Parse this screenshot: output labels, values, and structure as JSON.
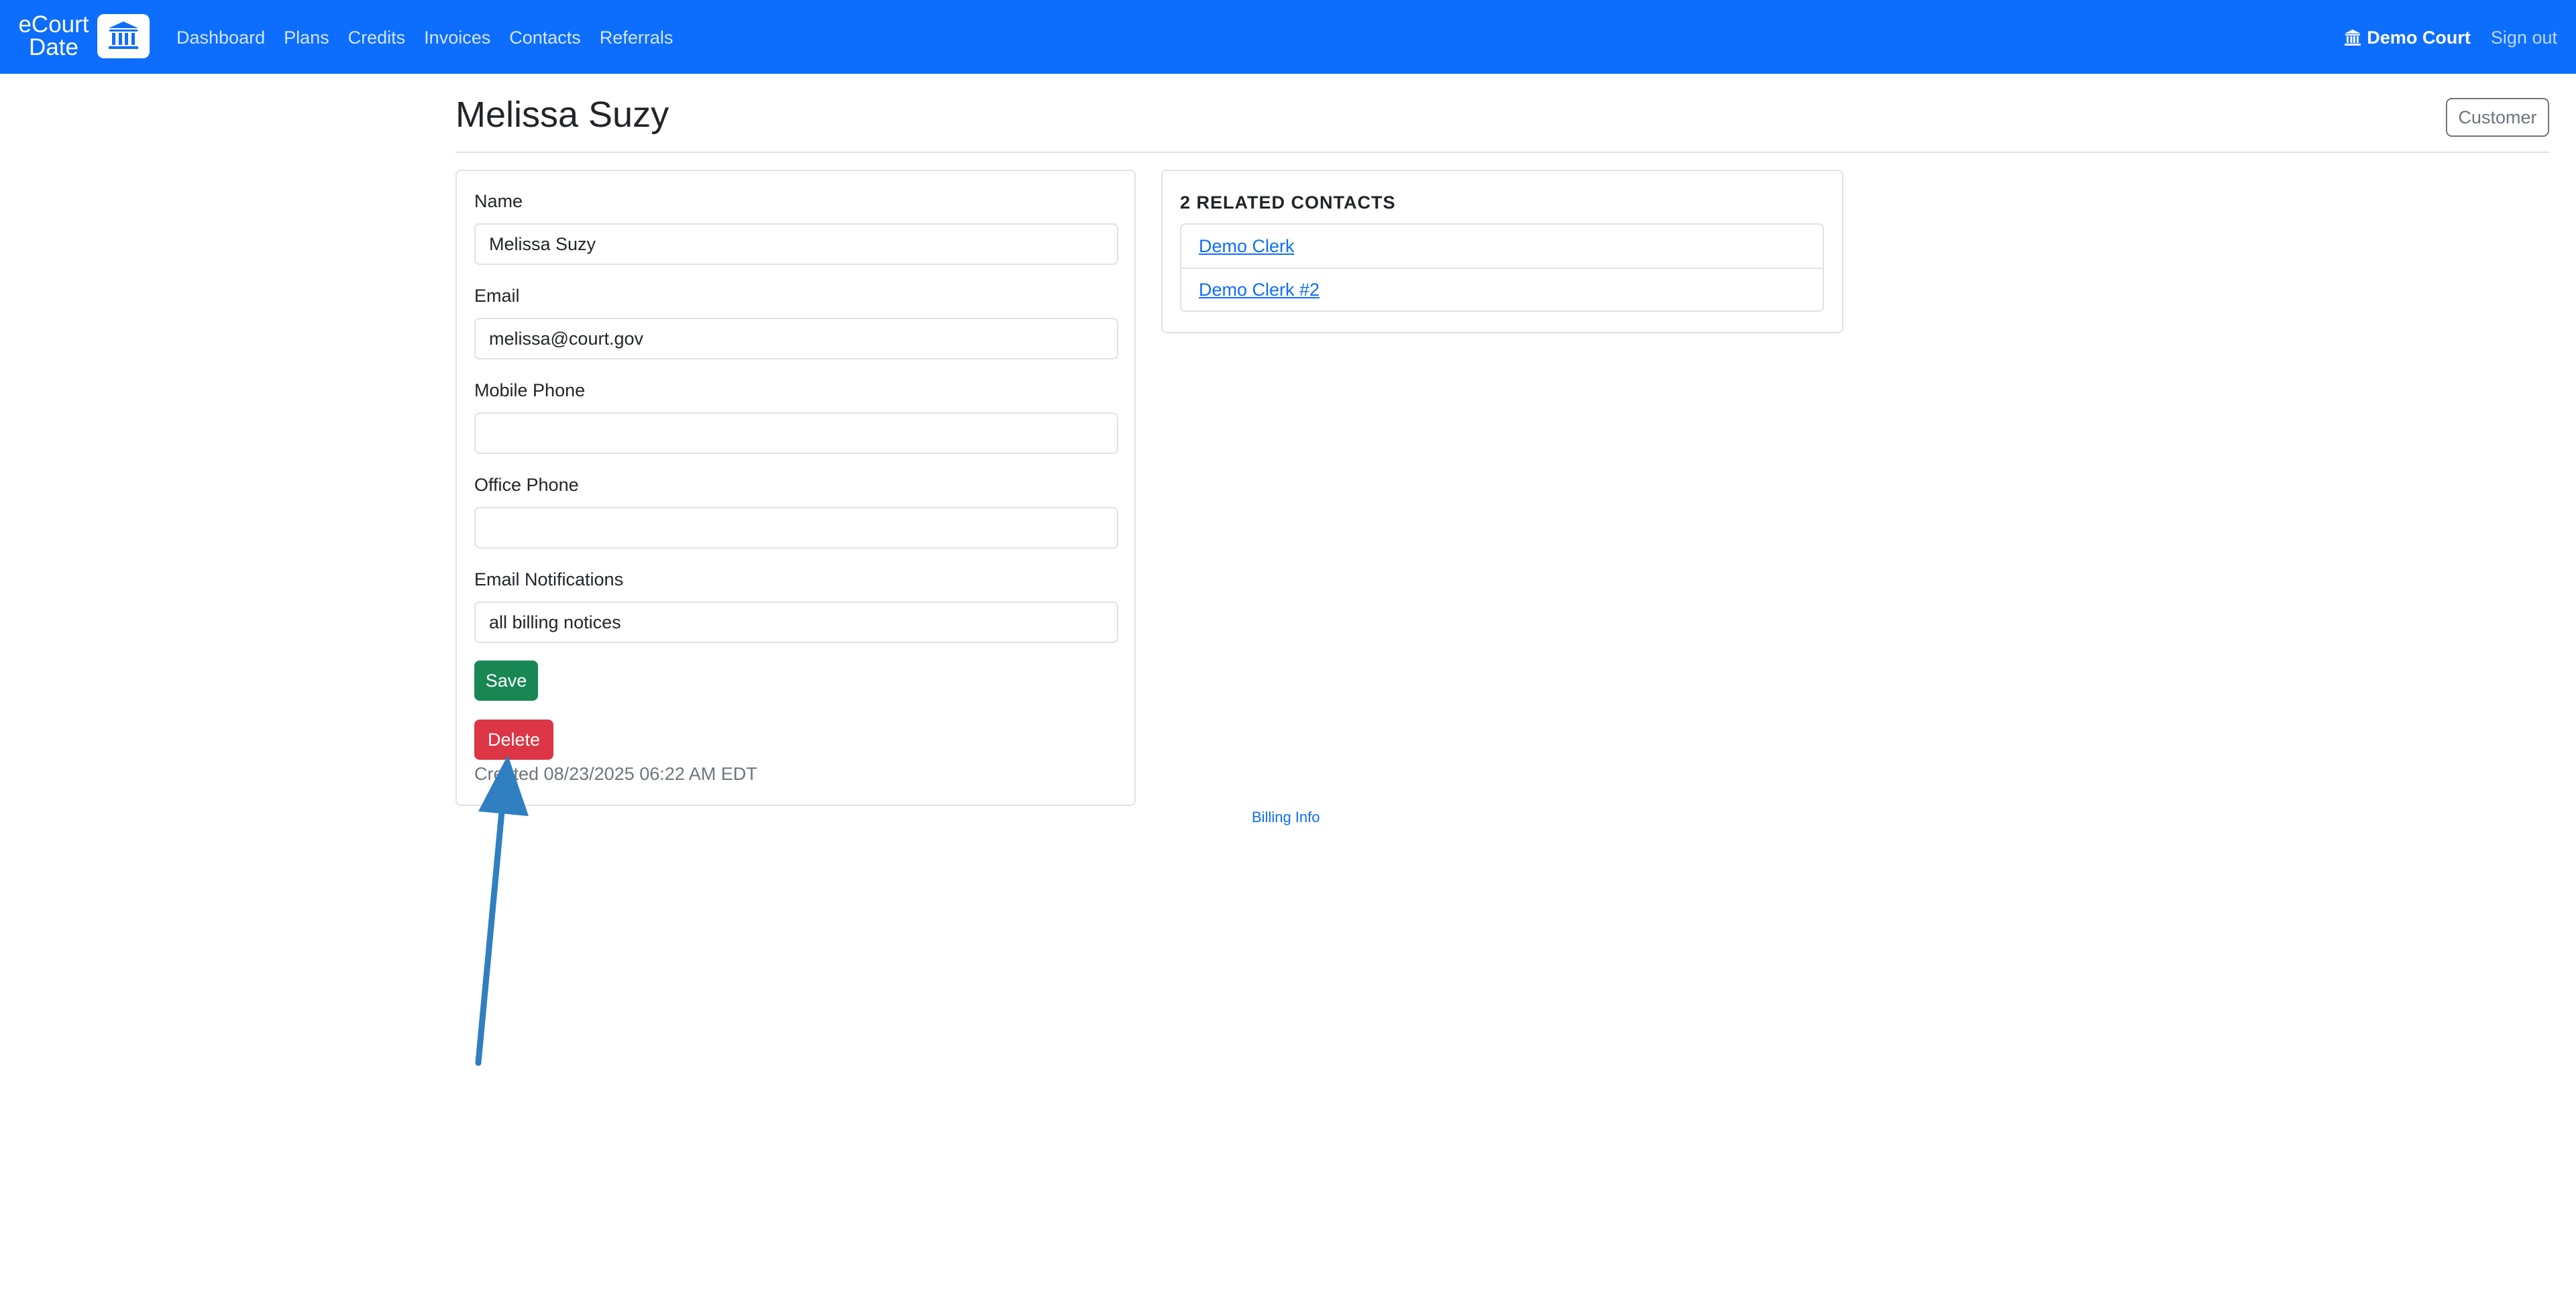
{
  "navbar": {
    "logo_line1": "eCourt",
    "logo_line2": "Date",
    "links": [
      "Dashboard",
      "Plans",
      "Credits",
      "Invoices",
      "Contacts",
      "Referrals"
    ],
    "court_name": "Demo Court",
    "sign_out": "Sign out",
    "brand_color": "#0d6efd"
  },
  "header": {
    "title": "Melissa Suzy",
    "customer_label": "Customer"
  },
  "form": {
    "name_label": "Name",
    "name_value": "Melissa Suzy",
    "email_label": "Email",
    "email_value": "melissa@court.gov",
    "mobile_label": "Mobile Phone",
    "mobile_value": "",
    "office_label": "Office Phone",
    "office_value": "",
    "notifications_label": "Email Notifications",
    "notifications_value": "all billing notices",
    "save_label": "Save",
    "delete_label": "Delete",
    "created_text": "Created 08/23/2025 06:22 AM EDT"
  },
  "related": {
    "title": "2 RELATED CONTACTS",
    "contacts": [
      "Demo Clerk",
      "Demo Clerk #2"
    ]
  },
  "footer": {
    "billing_link": "Billing Info"
  },
  "colors": {
    "save": "#198754",
    "delete": "#dc3545",
    "annotation_arrow": "#2f7fc1"
  }
}
